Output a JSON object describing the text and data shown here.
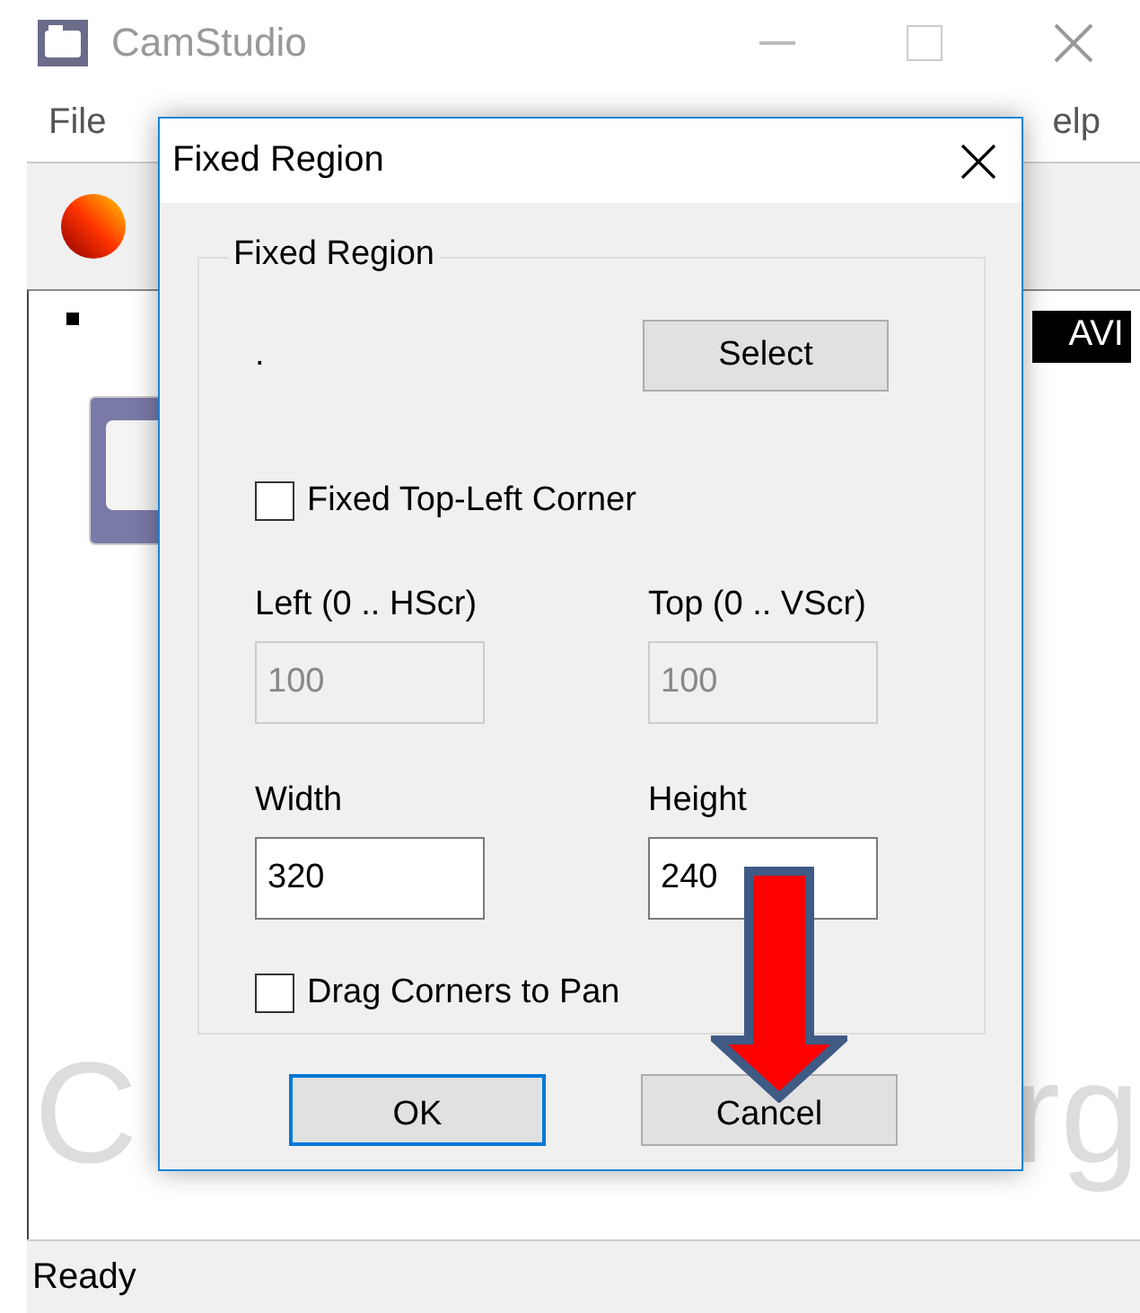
{
  "main_window": {
    "title": "CamStudio",
    "menu": [
      "File",
      "elp"
    ],
    "badge": "AVI",
    "background_text": [
      "C",
      "rg"
    ],
    "status_bar": "Ready"
  },
  "dialog": {
    "title": "Fixed Region",
    "group_label": "Fixed Region",
    "region_text": ".",
    "select_button": "Select",
    "fixed_corner": {
      "label": "Fixed Top-Left Corner",
      "checked": false
    },
    "fields": [
      {
        "label": "Left (0 .. HScr)",
        "value": "100",
        "disabled": true
      },
      {
        "label": "Top (0 .. VScr)",
        "value": "100",
        "disabled": true
      },
      {
        "label": "Width",
        "value": "320",
        "disabled": false
      },
      {
        "label": "Height",
        "value": "240",
        "disabled": false
      }
    ],
    "drag_corners": {
      "label": "Drag Corners to Pan",
      "checked": false
    },
    "buttons": [
      {
        "label": "OK",
        "default": true
      },
      {
        "label": "Cancel",
        "default": false
      }
    ]
  }
}
